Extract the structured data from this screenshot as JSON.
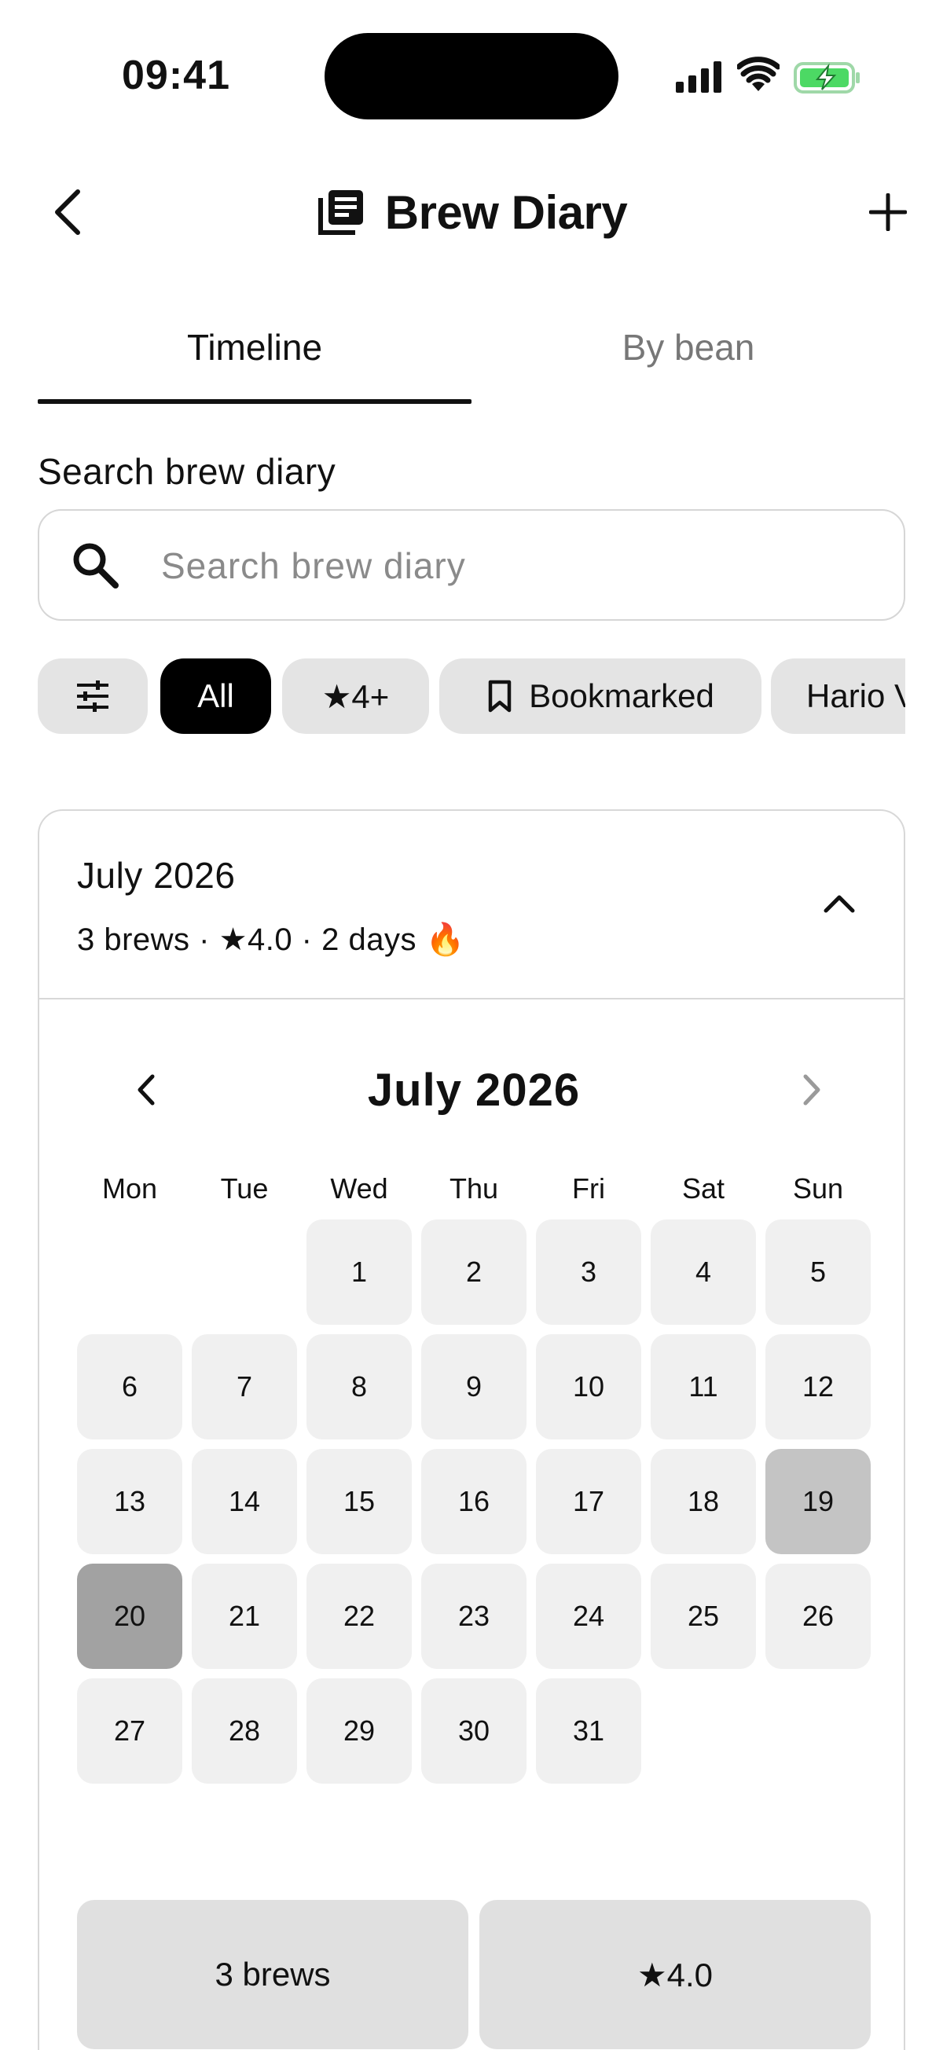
{
  "status": {
    "time": "09:41"
  },
  "header": {
    "title": "Brew Diary"
  },
  "tabs": [
    {
      "label": "Timeline",
      "active": true
    },
    {
      "label": "By bean",
      "active": false
    }
  ],
  "search": {
    "label": "Search brew diary",
    "placeholder": "Search brew diary",
    "value": ""
  },
  "chips": {
    "filter_icon": "sliders-icon",
    "all": "All",
    "rating": "★4+",
    "bookmarked": "Bookmarked",
    "hario": "Hario V"
  },
  "month_card": {
    "title": "July 2026",
    "summary": "3 brews · ★4.0 · 2 days 🔥",
    "calendar": {
      "title": "July 2026",
      "weekdays": [
        "Mon",
        "Tue",
        "Wed",
        "Thu",
        "Fri",
        "Sat",
        "Sun"
      ],
      "first_weekday_index": 2,
      "days_in_month": 31,
      "highlight_light": [
        19
      ],
      "highlight_dark": [
        20
      ]
    },
    "stats": {
      "brews": "3 brews",
      "rating": "★4.0"
    }
  },
  "colors": {
    "accent": "#000000",
    "chip_bg": "#e4e4e4",
    "day_bg": "#f0f0f0",
    "day_light": "#c4c4c4",
    "day_dark": "#a2a2a2",
    "battery_green": "#4cd964"
  }
}
